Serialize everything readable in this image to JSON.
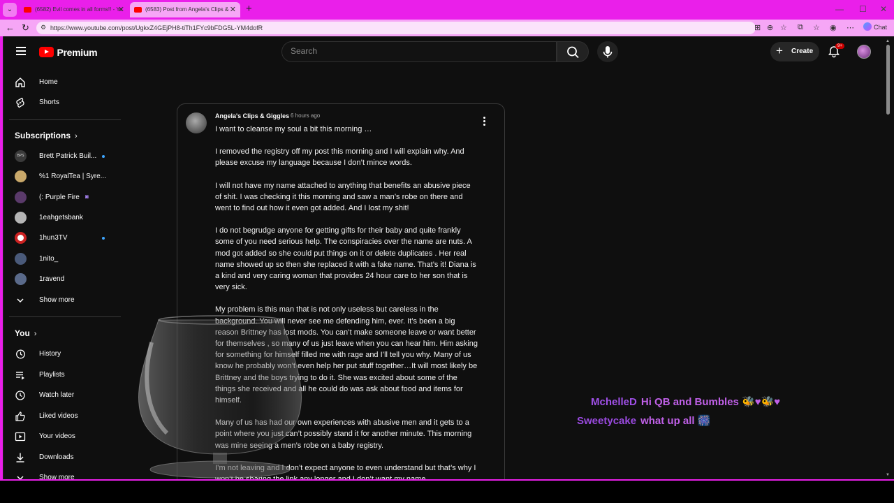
{
  "browser": {
    "tabs": [
      {
        "title": "(6582) Evil comes in all forms!! - Yo"
      },
      {
        "title": "(6583) Post from Angela's Clips &"
      }
    ],
    "url": "https://www.youtube.com/post/UgkxZ4GEjPH8-tiTh1FYc9bFDG5L-YM4dofR",
    "chat_label": "Chat"
  },
  "youtube": {
    "brand": "Premium",
    "search_placeholder": "Search",
    "create_label": "Create",
    "notification_count": "9+"
  },
  "sidebar": {
    "main": [
      {
        "label": "Home",
        "icon": "home-icon"
      },
      {
        "label": "Shorts",
        "icon": "shorts-icon"
      }
    ],
    "subscriptions_title": "Subscriptions",
    "subscriptions": [
      {
        "label": "Brett Patrick Buil...",
        "avatar_text": "BPS",
        "color": "#3a3a3a",
        "indicator": "dot"
      },
      {
        "label": "%1 RoyalTea | Syre...",
        "color": "#c9a86a",
        "indicator": "none"
      },
      {
        "label": "(: Purple Fire",
        "color": "#5a3a6a",
        "indicator": "live"
      },
      {
        "label": "1eahgetsbank",
        "color": "#b5b5b5",
        "indicator": "none"
      },
      {
        "label": "1hun3TV",
        "color": "#cc2222",
        "indicator": "dot"
      },
      {
        "label": "1nito_",
        "color": "#4a5a7a",
        "indicator": "none"
      },
      {
        "label": "1ravend",
        "color": "#5a6a8a",
        "indicator": "none"
      }
    ],
    "show_more": "Show more",
    "you_title": "You",
    "you_items": [
      {
        "label": "History",
        "icon": "history-icon"
      },
      {
        "label": "Playlists",
        "icon": "playlists-icon"
      },
      {
        "label": "Watch later",
        "icon": "watch-later-icon"
      },
      {
        "label": "Liked videos",
        "icon": "thumbs-up-icon"
      },
      {
        "label": "Your videos",
        "icon": "your-videos-icon"
      },
      {
        "label": "Downloads",
        "icon": "download-icon"
      }
    ],
    "show_more_2": "Show more"
  },
  "post": {
    "author": "Angela's Clips & Giggles",
    "time": "6 hours ago",
    "paragraphs": [
      "I want to cleanse my soul a bit this morning …",
      "I removed the registry off my post this morning and I will explain why. And please excuse my language because I don’t mince words.",
      "I will not have my name attached to anything that benefits an abusive piece of shit. I was checking it this morning and saw a man’s robe on there and went to find out how it even got added. And I lost my shit!",
      "I do not begrudge anyone for getting gifts for their baby and quite frankly some of you need serious help. The conspiracies over the name are nuts. A mod got added so she could put things on it or delete duplicates . Her real name showed up so then she replaced it with a fake name. That’s it! Diana is a kind and very caring woman that provides 24 hour care to her son that is very sick.",
      "My problem is this man that is not only useless but careless in the background. You will never see me defending him, ever. It’s been a big reason Brittney has lost mods. You can’t make someone leave or want better for themselves , so many of us just leave when you can hear him. Him asking for something for himself filled me with rage and I’ll tell you why. Many of us know he probably won’t even help her put stuff together…It will most likely be Brittney and the boys trying to do it. She was excited about some of the things she received and all he could do was ask about food and items for himself.",
      "Many of us has had our own experiences with abusive men and it gets to a point where you just can’t possibly stand it for another minute. This morning was mine seeing a men’s robe on a baby registry.",
      "I’m not leaving and I don’t expect anyone to even understand but that’s why I won’t be sharing the link any longer and I don’t want my name"
    ]
  },
  "chat_overlay": [
    {
      "user": "MchelleD",
      "message": "Hi QB and Bumbles 🐝♥🐝♥"
    },
    {
      "user": "Sweetycake",
      "message": "what up all 🎆"
    }
  ]
}
